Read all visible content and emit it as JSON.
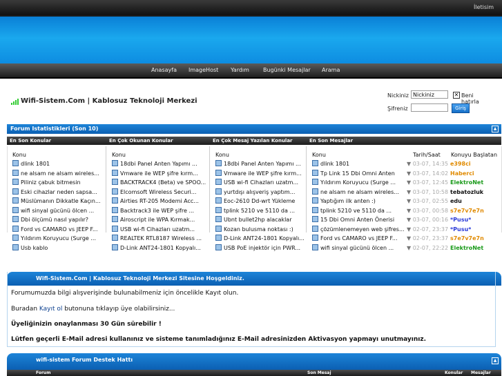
{
  "topbar": {
    "iletisim": "İletisim"
  },
  "nav": [
    "Anasayfa",
    "ImageHost",
    "Yardım",
    "Bugünki Mesajlar",
    "Arama"
  ],
  "brand": {
    "title": "Wifi-Sistem.Com | Kablosuz Teknoloji Merkezi"
  },
  "login": {
    "username_label": "Nickiniz",
    "username_value": "Nickiniz",
    "remember_label": "Beni hatırla",
    "password_label": "Şifreniz",
    "submit": "Giriş"
  },
  "stats": {
    "title": "Forum Istatistikleri (Son 10)",
    "headers": [
      "En Son Konular",
      "En Çok Okunan Konular",
      "En Çok Mesaj Yazılan Konular",
      "En Son Mesajlar"
    ],
    "sub_konu": "Konu",
    "sub_tarih": "Tarih/Saat",
    "sub_baslatan": "Konuyu Başlatan",
    "col1": [
      "dlink 1801",
      "ne alsam ne alsam wireles...",
      "Piliniz çabuk bitmesin",
      "Eski cihazlar neden sapsa...",
      "Müslümanın Dikkatle Kaçın...",
      "wifi sinyal gücünü ölcen ...",
      "Dbi ölçümü nasıl yapılır?",
      "Ford vs CAMARO vs JEEP F...",
      "Yıldırım Koruyucu (Surge ...",
      "Usb kablo"
    ],
    "col2": [
      "18dbi Panel Anten Yapımı ...",
      "Vmware ile WEP şifre kırm...",
      "BACKTRACK4 (Beta) ve SPOO...",
      "Elcomsoft Wireless Securi...",
      "Airties RT-205 Modemi Acc...",
      "Backtrack3 ile WEP şifre ...",
      "Airoscript ile WPA Kırmak...",
      "USB wi-fi Cihazları uzatm...",
      "REALTEK RTL8187 Wireless ...",
      "D-Link ANT24-1801 Kopyalı..."
    ],
    "col3": [
      "18dbi Panel Anten Yapımı ...",
      "Vmware ile WEP şifre kırm...",
      "USB wi-fi Cihazları uzatm...",
      "yurtdışı alışveriş yaptım...",
      "Eoc-2610 Dd-wrt Yükleme",
      "tplink 5210 ve 5110 da ...",
      "Ubnt bullet2hp alacaklar",
      "Kozan bulusma noktası :)",
      "D-Link ANT24-1801 Kopyalı...",
      "USB PoE injektör için PWR..."
    ],
    "col4": [
      {
        "t": "dlink 1801",
        "d": "03-07, 14:35",
        "u": "e398ci",
        "c": "#e08a00"
      },
      {
        "t": "Tp Link 15 Dbi Omni Anten",
        "d": "03-07, 14:02",
        "u": "Haberci",
        "c": "#e08a00"
      },
      {
        "t": "Yıldırım Koruyucu (Surge ...",
        "d": "03-07, 12:45",
        "u": "ElektroNet",
        "c": "#1a9a1a"
      },
      {
        "t": "ne alsam ne alsam wireles...",
        "d": "03-07, 10:58",
        "u": "tebatozluk",
        "c": "#111"
      },
      {
        "t": "Yaptığım ilk anten :)",
        "d": "03-07, 02:55",
        "u": "edu",
        "c": "#111"
      },
      {
        "t": "tplink 5210 ve 5110 da ...",
        "d": "03-07, 00:58",
        "u": "s7e7v7e7n",
        "c": "#e08a00"
      },
      {
        "t": "15 Dbi Omni Anten Önerisi",
        "d": "03-07, 00:16",
        "u": "*Pusu*",
        "c": "#2a3ad8"
      },
      {
        "t": "çözümlenemeyen web şifres...",
        "d": "02-07, 23:37",
        "u": "*Pusu*",
        "c": "#2a3ad8"
      },
      {
        "t": "Ford vs CAMARO vs JEEP F...",
        "d": "02-07, 23:37",
        "u": "s7e7v7e7n",
        "c": "#e08a00"
      },
      {
        "t": "wifi sinyal gücünü ölcen ...",
        "d": "02-07, 22:22",
        "u": "ElektroNet",
        "c": "#1a9a1a"
      }
    ]
  },
  "welcome": {
    "title": "Wifi-Sistem.Com | Kablosuz Teknoloji Merkezi Sitesine Hoşgeldiniz.",
    "line1": "Forumumuzda bilgi alışverişinde bulunabilmeniz için öncelikle Kayıt olun.",
    "line2_a": "Buradan ",
    "line2_b": "Kayıt ol",
    "line2_c": " butonuna tıklayıp üye olabilirsiniz...",
    "line3": "Üyeliğinizin onaylanması 30 Gün sürebilir !",
    "line4": "Lütfen geçerli E-Mail adresi kullanınız ve sisteme tanımladığınız E-Mail adresinizden Aktivasyon yapmayı unutmayınız."
  },
  "support": {
    "title": "wifi-sistem Forum Destek Hattı",
    "headers": [
      "Forum",
      "Son Mesaj",
      "Konular",
      "Mesajlar"
    ]
  },
  "colors": {
    "accent": "#0b6fc8",
    "nav": "#2a2a2a"
  }
}
